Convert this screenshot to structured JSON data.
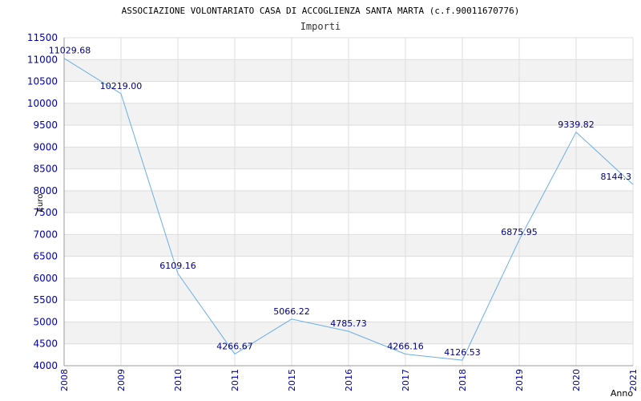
{
  "chart_data": {
    "type": "line",
    "title": "ASSOCIAZIONE VOLONTARIATO CASA DI ACCOGLIENZA SANTA MARTA (c.f.90011670776)",
    "subtitle": "Importi",
    "xlabel": "Anno",
    "ylabel": "Euro",
    "categories": [
      "2008",
      "2009",
      "2010",
      "2011",
      "2015",
      "2016",
      "2017",
      "2018",
      "2019",
      "2020",
      "2021"
    ],
    "values": [
      11029.68,
      10219.0,
      6109.16,
      4266.67,
      5066.22,
      4785.73,
      4266.16,
      4126.53,
      6875.95,
      9339.82,
      8144.3
    ],
    "value_labels": [
      "11029.68",
      "10219.00",
      "6109.16",
      "4266.67",
      "5066.22",
      "4785.73",
      "4266.16",
      "4126.53",
      "6875.95",
      "9339.82",
      "8144.3"
    ],
    "yticks": [
      "4000",
      "4500",
      "5000",
      "5500",
      "6000",
      "6500",
      "7000",
      "7500",
      "8000",
      "8500",
      "9000",
      "9500",
      "10000",
      "10500",
      "11000",
      "11500"
    ],
    "ylim": [
      4000,
      11500
    ],
    "grid": true,
    "colors": {
      "line": "#6aaee8",
      "tick_text": "#0000aa",
      "label_text": "#000080",
      "band": "#f2f2f2",
      "gridline": "#dddddd"
    }
  }
}
